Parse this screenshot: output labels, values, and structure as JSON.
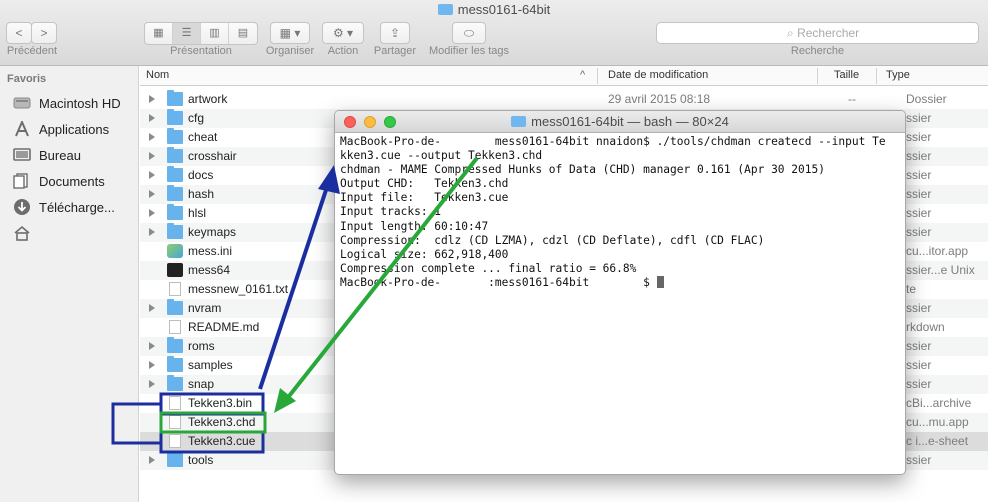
{
  "finder": {
    "title": "mess0161-64bit",
    "toolbar": {
      "nav_back": "<",
      "nav_fwd": ">",
      "back_label": "Précédent",
      "view_label": "Présentation",
      "organize_label": "Organiser",
      "action_label": "Action",
      "share_label": "Partager",
      "tags_label": "Modifier les tags",
      "search_placeholder": "Rechercher",
      "search_label": "Recherche"
    },
    "sidebar": {
      "heading": "Favoris",
      "items": [
        {
          "label": "Macintosh HD",
          "icon": "hard-drive-icon"
        },
        {
          "label": "Applications",
          "icon": "applications-icon"
        },
        {
          "label": "Bureau",
          "icon": "desktop-icon"
        },
        {
          "label": "Documents",
          "icon": "documents-icon"
        },
        {
          "label": "Télécharge...",
          "icon": "downloads-icon"
        },
        {
          "label": "",
          "icon": "home-icon"
        }
      ]
    },
    "columns": {
      "name": "Nom",
      "date": "Date de modification",
      "size": "Taille",
      "kind": "Type"
    },
    "rows": [
      {
        "name": "artwork",
        "date": "29 avril 2015 08:18",
        "size": "--",
        "kind": "Dossier",
        "type": "folder"
      },
      {
        "name": "cfg",
        "date": "",
        "size": "",
        "kind": "ssier",
        "type": "folder"
      },
      {
        "name": "cheat",
        "date": "",
        "size": "",
        "kind": "ssier",
        "type": "folder"
      },
      {
        "name": "crosshair",
        "date": "",
        "size": "",
        "kind": "ssier",
        "type": "folder"
      },
      {
        "name": "docs",
        "date": "",
        "size": "",
        "kind": "ssier",
        "type": "folder"
      },
      {
        "name": "hash",
        "date": "",
        "size": "",
        "kind": "ssier",
        "type": "folder"
      },
      {
        "name": "hlsl",
        "date": "",
        "size": "",
        "kind": "ssier",
        "type": "folder"
      },
      {
        "name": "keymaps",
        "date": "",
        "size": "",
        "kind": "ssier",
        "type": "folder"
      },
      {
        "name": "mess.ini",
        "date": "",
        "size": "",
        "kind": "cu...itor.app",
        "type": "app"
      },
      {
        "name": "mess64",
        "date": "",
        "size": "",
        "kind": "ssier...e Unix",
        "type": "term"
      },
      {
        "name": "messnew_0161.txt",
        "date": "",
        "size": "",
        "kind": "te",
        "type": "doc"
      },
      {
        "name": "nvram",
        "date": "",
        "size": "",
        "kind": "ssier",
        "type": "folder"
      },
      {
        "name": "README.md",
        "date": "",
        "size": "",
        "kind": "rkdown",
        "type": "doc"
      },
      {
        "name": "roms",
        "date": "",
        "size": "",
        "kind": "ssier",
        "type": "folder"
      },
      {
        "name": "samples",
        "date": "",
        "size": "",
        "kind": "ssier",
        "type": "folder"
      },
      {
        "name": "snap",
        "date": "",
        "size": "",
        "kind": "ssier",
        "type": "folder"
      },
      {
        "name": "Tekken3.bin",
        "date": "",
        "size": "",
        "kind": "cBi...archive",
        "type": "doc"
      },
      {
        "name": "Tekken3.chd",
        "date": "",
        "size": "",
        "kind": "cu...mu.app",
        "type": "doc"
      },
      {
        "name": "Tekken3.cue",
        "date": "",
        "size": "",
        "kind": "c i...e-sheet",
        "type": "doc"
      },
      {
        "name": "tools",
        "date": "",
        "size": "",
        "kind": "ssier",
        "type": "folder"
      }
    ]
  },
  "terminal": {
    "title": "mess0161-64bit — bash — 80×24",
    "lines": [
      "MacBook-Pro-de-        mess0161-64bit nnaidon$ ./tools/chdman createcd --input Te",
      "kken3.cue --output Tekken3.chd",
      "chdman - MAME Compressed Hunks of Data (CHD) manager 0.161 (Apr 30 2015)",
      "Output CHD:   Tekken3.chd",
      "Input file:   Tekken3.cue",
      "Input tracks: 1",
      "Input length: 60:10:47",
      "Compression:  cdlz (CD LZMA), cdzl (CD Deflate), cdfl (CD FLAC)",
      "Logical size: 662,918,400",
      "Compression complete ... final ratio = 66.8%",
      "MacBook-Pro-de-       :mess0161-64bit        $ "
    ]
  },
  "colors": {
    "annotation_blue": "#1b2ea0",
    "annotation_green": "#29a83a",
    "folder": "#69b3ec"
  }
}
